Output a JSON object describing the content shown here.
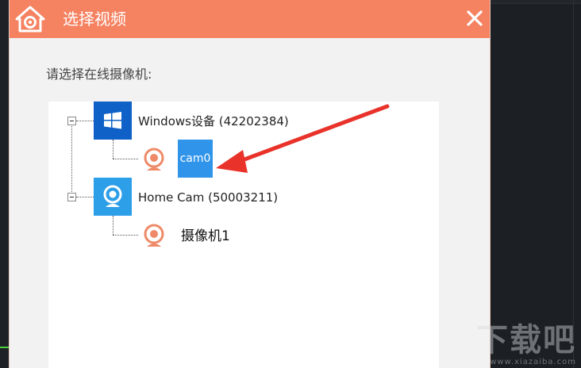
{
  "dialog": {
    "title": "选择视频",
    "close_glyph": "✕",
    "prompt": "请选择在线摄像机:"
  },
  "tree": {
    "devices": [
      {
        "label": "Windows设备 (42202384)",
        "icon": "windows-logo-icon",
        "expanded": true,
        "cameras": [
          {
            "label": "cam0",
            "icon": "webcam-icon",
            "selected": true
          }
        ]
      },
      {
        "label": "Home Cam (50003211)",
        "icon": "home-cam-icon",
        "expanded": true,
        "cameras": [
          {
            "label": "摄像机1",
            "icon": "webcam-icon",
            "selected": false
          }
        ]
      }
    ]
  },
  "annotation": {
    "arrow_color": "#e8322a",
    "points_to": "cam0"
  },
  "watermark": {
    "logo_text": "下载吧",
    "url": "www.xiazaiba.com"
  },
  "colors": {
    "titlebar": "#f58261",
    "selection": "#2f94ea",
    "windows_icon_bg": "#0f61c7",
    "homecam_icon_bg": "#2d9ee8",
    "cam_icon": "#ee8a68"
  }
}
